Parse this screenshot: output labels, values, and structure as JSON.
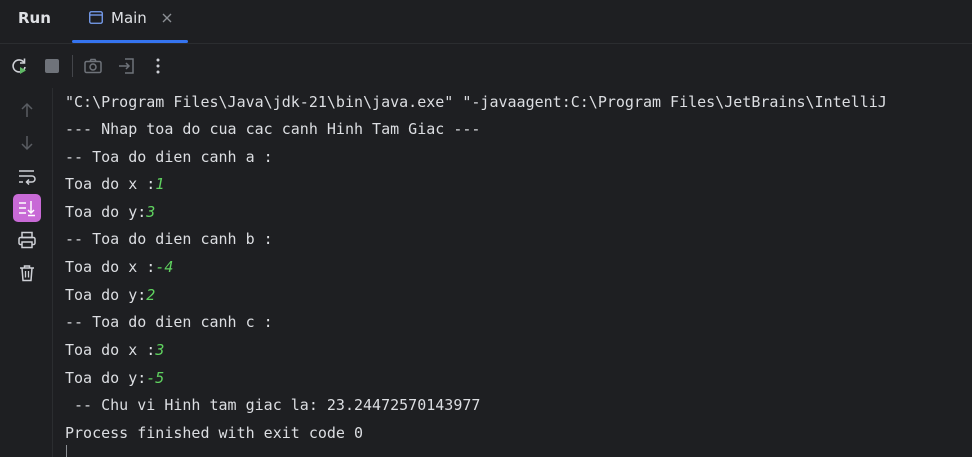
{
  "tool_window": {
    "title": "Run",
    "tab": {
      "label": "Main"
    }
  },
  "toolbar": {
    "buttons": [
      "rerun-icon",
      "stop-icon",
      "camera-icon",
      "restore-layout-icon",
      "more-icon"
    ]
  },
  "sidebar": {
    "buttons": [
      "arrow-up-icon",
      "arrow-down-icon",
      "soft-wrap-icon",
      "scroll-to-end-icon",
      "print-icon",
      "trash-icon"
    ]
  },
  "console": {
    "lines": [
      {
        "text": "\"C:\\Program Files\\Java\\jdk-21\\bin\\java.exe\" \"-javaagent:C:\\Program Files\\JetBrains\\IntelliJ",
        "input": ""
      },
      {
        "text": "--- Nhap toa do cua cac canh Hinh Tam Giac ---",
        "input": ""
      },
      {
        "text": "-- Toa do dien canh a :",
        "input": ""
      },
      {
        "text": "Toa do x :",
        "input": "1"
      },
      {
        "text": "Toa do y:",
        "input": "3"
      },
      {
        "text": "-- Toa do dien canh b :",
        "input": ""
      },
      {
        "text": "Toa do x :",
        "input": "-4"
      },
      {
        "text": "Toa do y:",
        "input": "2"
      },
      {
        "text": "-- Toa do dien canh c :",
        "input": ""
      },
      {
        "text": "Toa do x :",
        "input": "3"
      },
      {
        "text": "Toa do y:",
        "input": "-5"
      },
      {
        "text": " -- Chu vi Hinh tam giac la: 23.24472570143977",
        "input": ""
      },
      {
        "text": "Process finished with exit code 0",
        "input": ""
      }
    ]
  },
  "colors": {
    "background": "#1e1f22",
    "text": "#dcdee2",
    "user_input": "#5fd15f",
    "accent": "#3574f0",
    "active_toggle": "#c86ad6"
  }
}
